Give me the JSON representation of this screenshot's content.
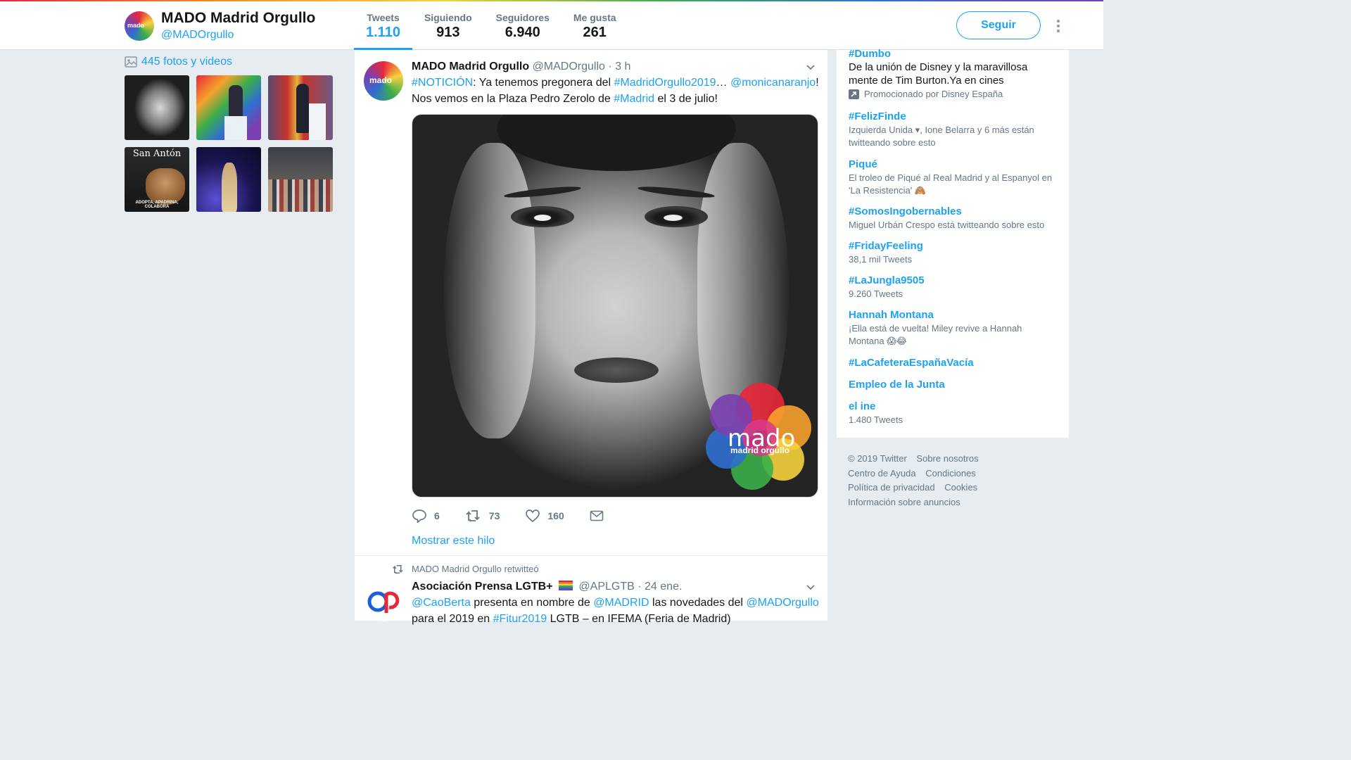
{
  "profile": {
    "name": "MADO Madrid Orgullo",
    "handle": "@MADOrgullo",
    "avatar_text": "mado"
  },
  "stats": [
    {
      "label": "Tweets",
      "value": "1.110"
    },
    {
      "label": "Siguiendo",
      "value": "913"
    },
    {
      "label": "Seguidores",
      "value": "6.940"
    },
    {
      "label": "Me gusta",
      "value": "261"
    }
  ],
  "follow_button": "Seguir",
  "photos": {
    "link": "445 fotos y videos",
    "thumb_san_anton": "San Antón",
    "thumb_adopta": "ADOPTA, APADRINA, COLABORA"
  },
  "tweet1": {
    "name": "MADO Madrid Orgullo",
    "handle": "@MADOrgullo",
    "time": "· 3 h",
    "line1_tag": "#NOTICIÓN",
    "line1_text": ": Ya tenemos pregonera del ",
    "line1_tag2": "#MadridOrgullo2019",
    "line1_ellipsis": "… ",
    "line1_mention": "@monicanaranjo",
    "line1_end": "!",
    "line2_text": "Nos vemos en la Plaza Pedro Zerolo de ",
    "line2_tag": "#Madrid",
    "line2_end": " el 3 de julio!",
    "logo_word": "mado",
    "logo_sub": "madrid orgullo",
    "replies": "6",
    "retweets": "73",
    "likes": "160",
    "show_thread": "Mostrar este hilo"
  },
  "retweet_label": "MADO Madrid Orgullo retwitteó",
  "tweet2": {
    "name": "Asociación Prensa LGTB+",
    "handle": "@APLGTB",
    "time": "· 24 ene.",
    "m1": "@CaoBerta",
    "t1": " presenta en nombre de ",
    "m2": "@MADRID",
    "t2": " las novedades del ",
    "m3": "@MADOrgullo",
    "t3": "para el 2019 en ",
    "m4": "#Fitur2019",
    "t4": " LGTB – en IFEMA (Feria de Madrid)"
  },
  "trends": [
    {
      "name": "#Dumbo",
      "desc": "De la unión de Disney y la maravillosa mente de Tim Burton.Ya en cines",
      "promo": "Promocionado por Disney España"
    },
    {
      "name": "#FelizFinde",
      "sub": "Izquierda Unida ▾, Ione Belarra y 6 más están twitteando sobre esto"
    },
    {
      "name": "Piqué",
      "sub": "El troleo de Piqué al Real Madrid y al Espanyol en 'La Resistencia' 🙈"
    },
    {
      "name": "#SomosIngobernables",
      "sub": "Miguel Urbán Crespo está twitteando sobre esto"
    },
    {
      "name": "#FridayFeeling",
      "sub": "38,1 mil Tweets"
    },
    {
      "name": "#LaJungla9505",
      "sub": "9.260 Tweets"
    },
    {
      "name": "Hannah Montana",
      "sub": "¡Ella está de vuelta! Miley revive a Hannah Montana 😱😂"
    },
    {
      "name": "#LaCafeteraEspañaVacía"
    },
    {
      "name": "Empleo de la Junta"
    },
    {
      "name": "el ine",
      "sub": "1.480 Tweets"
    }
  ],
  "footer": {
    "copyright": "© 2019 Twitter",
    "about": "Sobre nosotros",
    "help": "Centro de Ayuda",
    "terms": "Condiciones",
    "privacy": "Política de privacidad",
    "cookies": "Cookies",
    "ads": "Información sobre anuncios"
  },
  "colors": {
    "accent": "#1da1f2",
    "background": "#e6ecf0",
    "muted": "#657786"
  }
}
